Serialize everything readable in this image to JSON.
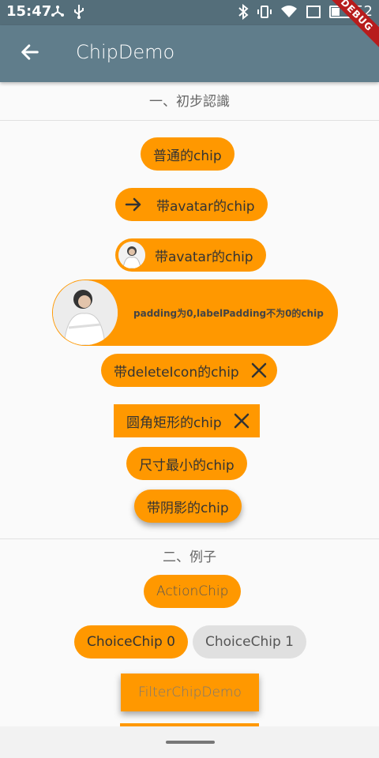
{
  "status_bar": {
    "time": "15:47",
    "battery_level": "52",
    "icons": [
      "fork-icon",
      "usb-icon",
      "bluetooth-icon",
      "vibrate-icon",
      "wifi-icon",
      "screenshot-icon",
      "battery-icon"
    ]
  },
  "app_bar": {
    "title": "ChipDemo",
    "back_icon": "arrow-back-icon",
    "debug_label": "DEBUG"
  },
  "sections": [
    {
      "title": "一、初步認識"
    },
    {
      "title": "二、例子"
    }
  ],
  "chips": {
    "plain": "普通的chip",
    "avatar_arrow": "带avatar的chip",
    "avatar_photo": "带avatar的chip",
    "padding": "padding为0,labelPadding不为0的chip",
    "delete_icon": "带deleteIcon的chip",
    "rounded_rect": "圆角矩形的chip",
    "min_size": "尺寸最小的chip",
    "shadow": "带阴影的chip"
  },
  "examples": {
    "action_chip": "ActionChip",
    "choice_chip_0": "ChoiceChip 0",
    "choice_chip_1": "ChoiceChip 1",
    "filter_chip": "FilterChipDemo"
  },
  "colors": {
    "accent": "#ff9800",
    "app_bar": "#607d8b",
    "status_bar": "#546e7a",
    "unselected_chip": "#e0e0e0"
  }
}
